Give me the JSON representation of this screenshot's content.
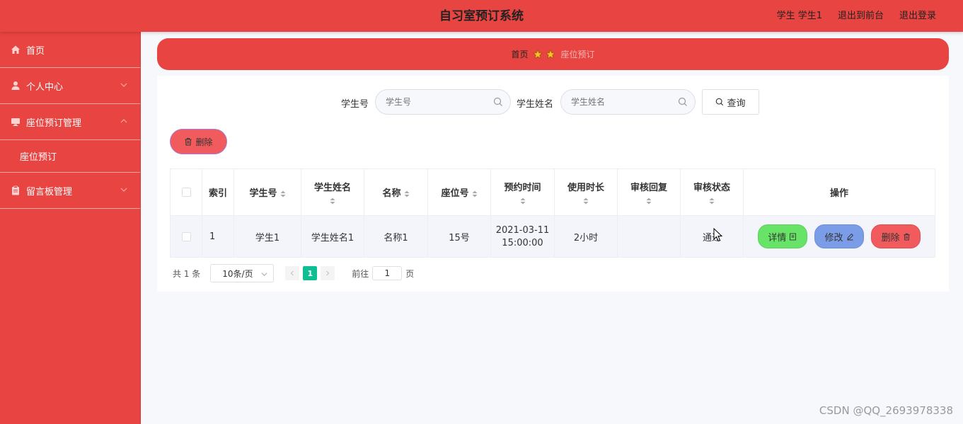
{
  "header": {
    "title": "自习室预订系统",
    "user_label": "学生 学生1",
    "to_front": "退出到前台",
    "logout": "退出登录"
  },
  "sidebar": {
    "items": [
      {
        "label": "首页",
        "icon": "home-icon"
      },
      {
        "label": "个人中心",
        "icon": "user-icon"
      },
      {
        "label": "座位预订管理",
        "icon": "monitor-icon",
        "expanded": true
      },
      {
        "label": "座位预订",
        "sub": true
      },
      {
        "label": "留言板管理",
        "icon": "clipboard-icon"
      }
    ]
  },
  "breadcrumb": {
    "home": "首页",
    "current": "座位预订"
  },
  "search": {
    "student_no_label": "学生号",
    "student_no_placeholder": "学生号",
    "student_name_label": "学生姓名",
    "student_name_placeholder": "学生姓名",
    "query_button": "查询"
  },
  "actions": {
    "batch_delete": "删除"
  },
  "table": {
    "headers": {
      "index": "索引",
      "student_no": "学生号",
      "student_name": "学生姓名",
      "name": "名称",
      "seat_no": "座位号",
      "reserve_time": "预约时间",
      "duration": "使用时长",
      "review_reply": "审核回复",
      "review_status": "审核状态",
      "operations": "操作"
    },
    "rows": [
      {
        "index": "1",
        "student_no": "学生1",
        "student_name": "学生姓名1",
        "name": "名称1",
        "seat_no": "15号",
        "reserve_date": "2021-03-11",
        "reserve_clock": "15:00:00",
        "duration": "2小时",
        "review_reply": "",
        "review_status": "通过",
        "btn_detail": "详情",
        "btn_edit": "修改",
        "btn_delete": "删除"
      }
    ]
  },
  "pagination": {
    "total": "共 1 条",
    "page_size": "10条/页",
    "current_page": "1",
    "goto_prefix": "前往",
    "goto_value": "1",
    "goto_suffix": "页"
  },
  "watermark": "CSDN @QQ_2693978338",
  "colors": {
    "primary_red": "#e84441",
    "detail_green": "#67e367",
    "edit_blue": "#7b9de8",
    "delete_red": "#f15b5d",
    "page_active": "#0fbe93"
  }
}
